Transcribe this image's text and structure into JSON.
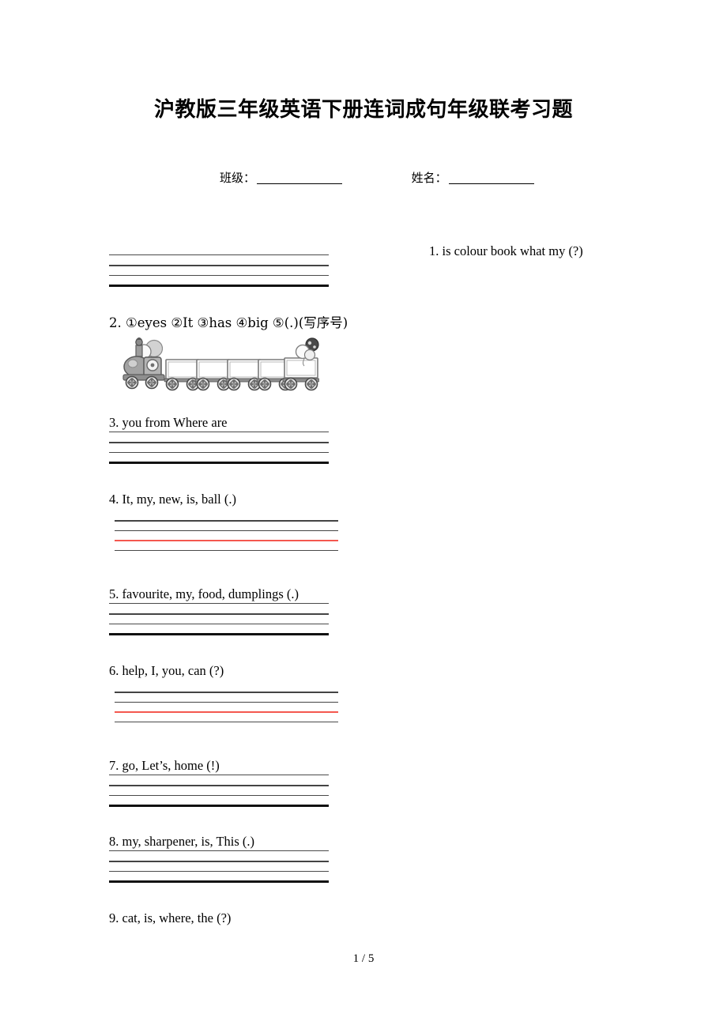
{
  "document": {
    "title": "沪教版三年级英语下册连词成句年级联考习题",
    "page_footer": "1 / 5"
  },
  "student_info": {
    "class_label": "班级：",
    "name_label": "姓名："
  },
  "questions": [
    {
      "number": "1.",
      "text": "1. is  colour  book what  my (?)",
      "position": "right",
      "lines": 4,
      "red_line_index": null
    },
    {
      "number": "2.",
      "text": "2. ①eyes ②It  ③has ④big ⑤(.)(写序号)",
      "position": "left",
      "illustration": "train-with-five-cars",
      "lines": 0,
      "red_line_index": null
    },
    {
      "number": "3.",
      "text": "3. you   from   Where   are",
      "position": "left",
      "lines": 4,
      "red_line_index": null
    },
    {
      "number": "4.",
      "text": "4. It, my, new, is, ball (.)",
      "position": "left",
      "lines": 4,
      "red_line_index": 3
    },
    {
      "number": "5.",
      "text": "5. favourite, my, food, dumplings (.)",
      "position": "left",
      "lines": 4,
      "red_line_index": null
    },
    {
      "number": "6.",
      "text": "6. help, I, you, can (?)",
      "position": "left",
      "lines": 4,
      "red_line_index": 3
    },
    {
      "number": "7.",
      "text": "7. go, Let’s, home (!)",
      "position": "left",
      "lines": 4,
      "red_line_index": null
    },
    {
      "number": "8.",
      "text": "8. my, sharpener, is, This (.)",
      "position": "left",
      "lines": 4,
      "red_line_index": null
    },
    {
      "number": "9.",
      "text": "9. cat, is, where, the (?)",
      "position": "left",
      "lines": 0,
      "red_line_index": null
    }
  ],
  "colors": {
    "text": "#000000",
    "rule": "#3a3a3a",
    "rule_strong": "#111111",
    "rule_red": "#f4584f",
    "illustration_gray": "#9a9a9a",
    "illustration_dark": "#4a4a4a",
    "page_background": "#ffffff"
  },
  "illustration": {
    "name": "train-with-five-cars",
    "description_parts": [
      "locomotive",
      "balloons",
      "car-1",
      "car-2",
      "car-3",
      "car-4",
      "car-5"
    ]
  }
}
